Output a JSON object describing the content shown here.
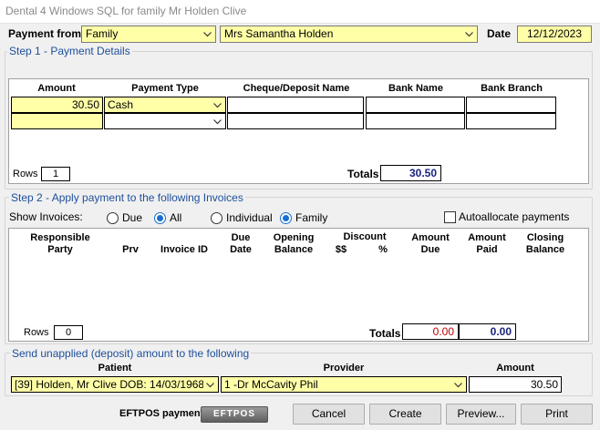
{
  "window": {
    "title": "Dental 4 Windows SQL for family Mr  Holden  Clive"
  },
  "header": {
    "payment_from_label": "Payment from",
    "payment_from_value": "Family",
    "payer_value": "Mrs Samantha  Holden",
    "date_label": "Date",
    "date_value": "12/12/2023"
  },
  "step1": {
    "title": "Step 1 - Payment Details",
    "columns": [
      "Amount",
      "Payment Type",
      "Cheque/Deposit Name",
      "Bank Name",
      "Bank Branch"
    ],
    "rows": [
      {
        "amount": "30.50",
        "type": "Cash",
        "cheque": "",
        "bank": "",
        "branch": ""
      },
      {
        "amount": "",
        "type": "",
        "cheque": "",
        "bank": "",
        "branch": ""
      }
    ],
    "rows_label": "Rows",
    "rows_value": "1",
    "totals_label": "Totals",
    "totals_value": "30.50"
  },
  "step2": {
    "title": "Step 2 - Apply payment to the following Invoices",
    "show_label": "Show Invoices:",
    "radio_due": "Due",
    "radio_all": "All",
    "radio_individual": "Individual",
    "radio_family": "Family",
    "autoallocate_label": "Autoallocate payments",
    "columns": {
      "responsible": "Responsible\nParty",
      "prv": "Prv",
      "invoice_id": "Invoice ID",
      "due_date": "Due\nDate",
      "opening": "Opening\nBalance",
      "discount": "Discount",
      "discount_amt": "$$",
      "discount_pct": "%",
      "amount_due": "Amount\nDue",
      "amount_paid": "Amount\nPaid",
      "closing": "Closing\nBalance"
    },
    "rows_label": "Rows",
    "rows_value": "0",
    "totals_label": "Totals",
    "total_due": "0.00",
    "total_paid": "0.00"
  },
  "unapplied": {
    "title": "Send unapplied (deposit) amount to the following",
    "patient_header": "Patient",
    "provider_header": "Provider",
    "amount_header": "Amount",
    "patient_value": "[39] Holden, Mr Clive DOB: 14/03/1968",
    "provider_value": "1 -Dr McCavity Phil",
    "amount_value": "30.50"
  },
  "footer": {
    "eftpos_label": "EFTPOS payment",
    "eftpos_logo_text": "EFTPOS",
    "cancel": "Cancel",
    "create": "Create",
    "preview": "Preview...",
    "print": "Print"
  },
  "colors": {
    "field_yellow": "#ffffa8",
    "group_title_blue": "#1d4f9c",
    "total_due_red": "#c00000",
    "total_paid_blue": "#1a237e",
    "radio_selected": "#1a6fd0"
  }
}
